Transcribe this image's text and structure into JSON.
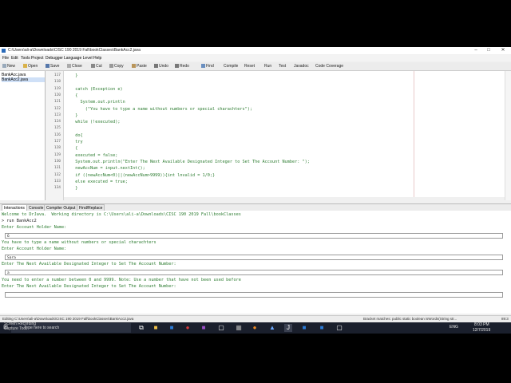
{
  "window": {
    "title": "C:\\Users\\ali-a\\Downloads\\CISC 190 2019 Fall\\bookClasses\\BankAcc2.java",
    "minimize_glyph": "–",
    "maximize_glyph": "□",
    "close_glyph": "✕"
  },
  "menu": [
    "File",
    "Edit",
    "Tools",
    "Project",
    "Debugger",
    "Language Level",
    "Help"
  ],
  "toolbar": {
    "new": "New",
    "open": "Open",
    "save": "Save",
    "close": "Close",
    "cut": "Cut",
    "copy": "Copy",
    "paste": "Paste",
    "undo": "Undo",
    "redo": "Redo",
    "find": "Find",
    "compile": "Compile",
    "reset": "Reset",
    "run": "Run",
    "test": "Test",
    "javadoc": "Javadoc",
    "code_coverage": "Code Coverage"
  },
  "files": [
    "BankAcc.java",
    "BankAcc2.java"
  ],
  "editor": {
    "lines": [
      {
        "num": "117",
        "code": "  }"
      },
      {
        "num": "118",
        "code": ""
      },
      {
        "num": "119",
        "code": "  catch (Exception e)"
      },
      {
        "num": "120",
        "code": "  {"
      },
      {
        "num": "121",
        "code": "    System.out.println"
      },
      {
        "num": "122",
        "code": "      (\"You have to type a name without numbers or special charachters\");"
      },
      {
        "num": "123",
        "code": "  }"
      },
      {
        "num": "124",
        "code": "  while (!executed);"
      },
      {
        "num": "125",
        "code": ""
      },
      {
        "num": "126",
        "code": "  do{"
      },
      {
        "num": "127",
        "code": "  try"
      },
      {
        "num": "128",
        "code": "  {"
      },
      {
        "num": "129",
        "code": "  executed = false;"
      },
      {
        "num": "130",
        "code": "  System.out.println(\"Enter The Next Available Designated Integer to Set The Account Number: \");"
      },
      {
        "num": "131",
        "code": "  newAccNum = input.nextInt();"
      },
      {
        "num": "132",
        "code": "  if ((newAccNum<0)||(newAccNum>9999)){int lnvalid = 1/0;}"
      },
      {
        "num": "133",
        "code": "  else executed = true;"
      },
      {
        "num": "134",
        "code": "  }"
      }
    ]
  },
  "tabs": [
    "Interactions",
    "Console",
    "Compiler Output",
    "Find/Replace"
  ],
  "console": {
    "welcome": "Welcome to DrJava.  Working directory is C:\\Users\\ali-a\\Downloads\\CISC 190 2019 Fall\\bookClasses",
    "run_cmd": "> run BankAcc2",
    "prompt1": "Enter Account Holder Name:",
    "input1": "6",
    "error1": "You have to type a name without numbers or special charachters",
    "prompt2": "Enter Account Holder Name:",
    "input2": "Sara",
    "prompt3": "Enter The Next Available Designated Integer to Set The Account Number:",
    "input3": "a",
    "error2": "You need to enter a number between 0 and 9999. Note: Use a number that have not been used before",
    "prompt4": "Enter The Next Available Designated Integer to Set The Account Number:",
    "input4": ""
  },
  "status": {
    "path": "Editing C:\\Users\\ali-a\\Downloads\\CISC 190 2019 Fall\\bookClasses\\BankAcc2.java",
    "match": "Bracket matches:     public static boolean isWords(String str...",
    "position": "89:3"
  },
  "taskbar": {
    "search": "Type here to search",
    "time": "8:03 PM",
    "date": "12/7/2019",
    "lang": "ENG",
    "overlay": "Screen Recording\nCapture Tool"
  }
}
